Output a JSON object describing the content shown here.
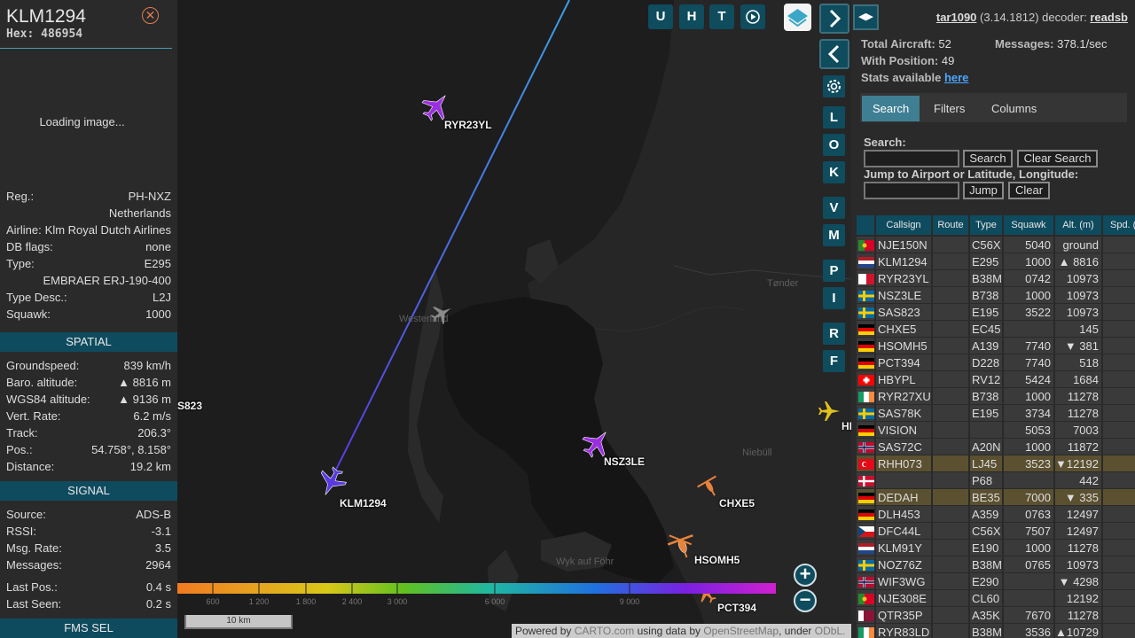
{
  "left": {
    "callsign": "KLM1294",
    "hex": "Hex: 486954",
    "loading": "Loading image...",
    "info": [
      {
        "k": "Reg.:",
        "v": "PH-NXZ"
      },
      {
        "k": "",
        "v": "Netherlands"
      },
      {
        "k": "Airline:",
        "v": "Klm Royal Dutch Airlines"
      },
      {
        "k": "DB flags:",
        "v": "none"
      },
      {
        "k": "Type:",
        "v": "E295"
      },
      {
        "k": "",
        "v": "EMBRAER ERJ-190-400"
      },
      {
        "k": "Type Desc.:",
        "v": "L2J"
      },
      {
        "k": "Squawk:",
        "v": "1000"
      }
    ],
    "spatial_title": "SPATIAL",
    "spatial": [
      {
        "k": "Groundspeed:",
        "v": "839 km/h"
      },
      {
        "k": "Baro. altitude:",
        "v": "▲ 8816 m"
      },
      {
        "k": "WGS84 altitude:",
        "v": "▲ 9136 m"
      },
      {
        "k": "Vert. Rate:",
        "v": "6.2 m/s"
      },
      {
        "k": "Track:",
        "v": "206.3°"
      },
      {
        "k": "Pos.:",
        "v": "54.758°, 8.158°"
      },
      {
        "k": "Distance:",
        "v": "19.2 km"
      }
    ],
    "signal_title": "SIGNAL",
    "signal": [
      {
        "k": "Source:",
        "v": "ADS-B"
      },
      {
        "k": "RSSI:",
        "v": "-3.1"
      },
      {
        "k": "Msg. Rate:",
        "v": "3.5"
      },
      {
        "k": "Messages:",
        "v": "2964"
      },
      {
        "k": "Last Pos.:",
        "v": "0.4 s"
      },
      {
        "k": "Last Seen:",
        "v": "0.2 s"
      }
    ],
    "fms_title": "FMS SEL"
  },
  "map": {
    "top_buttons": [
      "U",
      "H",
      "T"
    ],
    "side_buttons": [
      "L",
      "O",
      "K",
      "V",
      "M",
      "P",
      "I",
      "R",
      "F"
    ],
    "labels": {
      "ryr": "RYR23YL",
      "klm": "KLM1294",
      "nsz": "NSZ3LE",
      "chx": "CHXE5",
      "hso": "HSOMH5",
      "pct": "PCT394",
      "sas": "S823",
      "hi": "HI"
    },
    "places": {
      "tonder": "Tønder",
      "niebull": "Niebüll",
      "wyk": "Wyk auf Föhr",
      "westerland": "Westerland"
    },
    "colorbar_ticks": [
      "600",
      "1 200",
      "1 800",
      "2 400",
      "3 000",
      "6 000",
      "9 000"
    ],
    "scale": "10 km",
    "attribution": {
      "pre": "Powered by ",
      "carto": "CARTO.com",
      "mid": " using data by ",
      "osm": "OpenStreetMap",
      "post": ", under ",
      "odbl": "ODbL."
    },
    "colors": {
      "purple": "#9b2fe0",
      "orange": "#e8823a",
      "grey": "#8a8a8a",
      "yellow": "#e0c020",
      "track_top": "#3aa0e8",
      "track_bottom": "#5a3ae0"
    }
  },
  "right": {
    "arrows": "◀▶",
    "version": {
      "site": "tar1090",
      "ver": "(3.14.1812) decoder:",
      "decoder": "readsb"
    },
    "stats": {
      "total_label": "Total Aircraft:",
      "total": "52",
      "messages_label": "Messages:",
      "messages": "378.1/sec",
      "pos_label": "With Position:",
      "pos": "49",
      "stats_label": "Stats available",
      "stats_link": "here"
    },
    "tabs": [
      "Search",
      "Filters",
      "Columns"
    ],
    "search_label": "Search:",
    "search_btn": "Search",
    "clear_search_btn": "Clear Search",
    "jump_label": "Jump to Airport or Latitude, Longitude:",
    "jump_btn": "Jump",
    "clear_btn": "Clear",
    "headers": [
      "Callsign",
      "Route",
      "Type",
      "Squawk",
      "Alt. (m)",
      "Spd. (km"
    ],
    "rows": [
      {
        "flag": "pt",
        "callsign": "NJE150N",
        "route": "",
        "type": "C56X",
        "squawk": "5040",
        "alt": "ground",
        "hl": false
      },
      {
        "flag": "nl",
        "callsign": "KLM1294",
        "route": "",
        "type": "E295",
        "squawk": "1000",
        "alt": "▲  8816",
        "hl": false
      },
      {
        "flag": "mt",
        "callsign": "RYR23YL",
        "route": "",
        "type": "B38M",
        "squawk": "0742",
        "alt": "10973",
        "hl": false
      },
      {
        "flag": "se",
        "callsign": "NSZ3LE",
        "route": "",
        "type": "B738",
        "squawk": "1000",
        "alt": "10973",
        "hl": false
      },
      {
        "flag": "se",
        "callsign": "SAS823",
        "route": "",
        "type": "E195",
        "squawk": "3522",
        "alt": "10973",
        "hl": false
      },
      {
        "flag": "de",
        "callsign": "CHXE5",
        "route": "",
        "type": "EC45",
        "squawk": "",
        "alt": "145",
        "hl": false
      },
      {
        "flag": "de",
        "callsign": "HSOMH5",
        "route": "",
        "type": "A139",
        "squawk": "7740",
        "alt": "▼  381",
        "hl": false
      },
      {
        "flag": "de",
        "callsign": "PCT394",
        "route": "",
        "type": "D228",
        "squawk": "7740",
        "alt": "518",
        "hl": false
      },
      {
        "flag": "ch",
        "callsign": "HBYPL",
        "route": "",
        "type": "RV12",
        "squawk": "5424",
        "alt": "1684",
        "hl": false
      },
      {
        "flag": "ie",
        "callsign": "RYR27XU",
        "route": "",
        "type": "B738",
        "squawk": "1000",
        "alt": "11278",
        "hl": false
      },
      {
        "flag": "se",
        "callsign": "SAS78K",
        "route": "",
        "type": "E195",
        "squawk": "3734",
        "alt": "11278",
        "hl": false
      },
      {
        "flag": "de",
        "callsign": "VISION",
        "route": "",
        "type": "",
        "squawk": "5053",
        "alt": "7003",
        "hl": false
      },
      {
        "flag": "no",
        "callsign": "SAS72C",
        "route": "",
        "type": "A20N",
        "squawk": "1000",
        "alt": "11872",
        "hl": false
      },
      {
        "flag": "tr",
        "callsign": "RHH073",
        "route": "",
        "type": "LJ45",
        "squawk": "3523",
        "alt": "▼12192",
        "hl": true
      },
      {
        "flag": "dk",
        "callsign": "",
        "route": "",
        "type": "P68",
        "squawk": "",
        "alt": "442",
        "hl": false
      },
      {
        "flag": "de",
        "callsign": "DEDAH",
        "route": "",
        "type": "BE35",
        "squawk": "7000",
        "alt": "▼  335",
        "hl": true
      },
      {
        "flag": "de",
        "callsign": "DLH453",
        "route": "",
        "type": "A359",
        "squawk": "0763",
        "alt": "12497",
        "hl": false
      },
      {
        "flag": "cz",
        "callsign": "DFC44L",
        "route": "",
        "type": "C56X",
        "squawk": "7507",
        "alt": "12497",
        "hl": false
      },
      {
        "flag": "nl",
        "callsign": "KLM91Y",
        "route": "",
        "type": "E190",
        "squawk": "1000",
        "alt": "11278",
        "hl": false
      },
      {
        "flag": "se",
        "callsign": "NOZ76Z",
        "route": "",
        "type": "B38M",
        "squawk": "0765",
        "alt": "10973",
        "hl": false
      },
      {
        "flag": "no",
        "callsign": "WIF3WG",
        "route": "",
        "type": "E290",
        "squawk": "",
        "alt": "▼  4298",
        "hl": false
      },
      {
        "flag": "pt",
        "callsign": "NJE308E",
        "route": "",
        "type": "CL60",
        "squawk": "",
        "alt": "12192",
        "hl": false
      },
      {
        "flag": "qa",
        "callsign": "QTR35P",
        "route": "",
        "type": "A35K",
        "squawk": "7670",
        "alt": "11278",
        "hl": false
      },
      {
        "flag": "ie",
        "callsign": "RYR83LD",
        "route": "",
        "type": "B38M",
        "squawk": "3536",
        "alt": "▲10729",
        "hl": false
      }
    ]
  }
}
